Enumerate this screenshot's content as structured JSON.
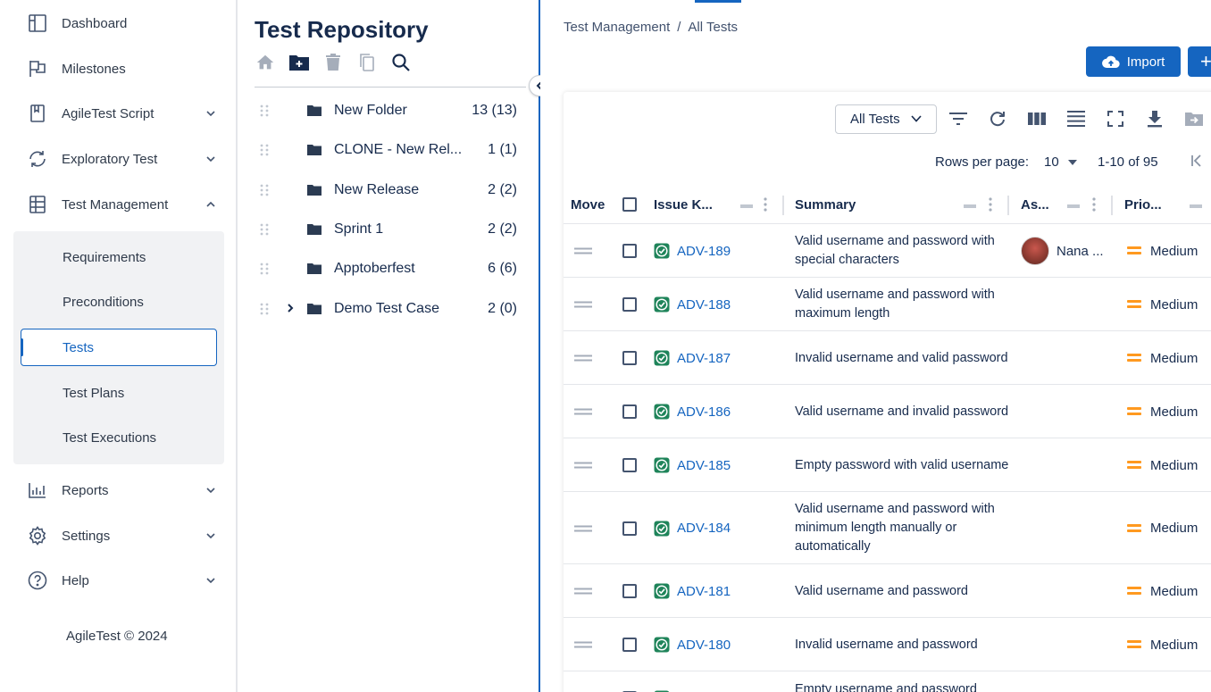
{
  "sidebar": {
    "items": [
      {
        "label": "Dashboard",
        "icon": "dashboard-icon"
      },
      {
        "label": "Milestones",
        "icon": "flag-icon"
      },
      {
        "label": "AgileTest Script",
        "icon": "bookmark-icon"
      },
      {
        "label": "Exploratory Test",
        "icon": "refresh-icon"
      },
      {
        "label": "Test Management",
        "icon": "list-icon"
      },
      {
        "label": "Reports",
        "icon": "bar-chart-icon"
      },
      {
        "label": "Settings",
        "icon": "gear-icon"
      },
      {
        "label": "Help",
        "icon": "help-icon"
      }
    ],
    "subitems": [
      {
        "label": "Requirements"
      },
      {
        "label": "Preconditions"
      },
      {
        "label": "Tests"
      },
      {
        "label": "Test Plans"
      },
      {
        "label": "Test Executions"
      }
    ],
    "active_subitem": "Tests",
    "footer": "AgileTest © 2024"
  },
  "repository": {
    "title": "Test Repository",
    "folders": [
      {
        "name": "New Folder",
        "count": "13 (13)"
      },
      {
        "name": "CLONE - New Rel...",
        "count": "1 (1)"
      },
      {
        "name": "New Release",
        "count": "2 (2)"
      },
      {
        "name": "Sprint 1",
        "count": "2 (2)"
      },
      {
        "name": "Apptoberfest",
        "count": "6 (6)"
      },
      {
        "name": "Demo Test Case",
        "count": "2 (0)"
      }
    ]
  },
  "main": {
    "breadcrumb": [
      "Test Management",
      "/",
      "All Tests"
    ],
    "import_label": "Import",
    "add_label": "+",
    "view_select": "All Tests",
    "pager": {
      "rows_label": "Rows per page:",
      "rows_value": "10",
      "range": "1-10 of 95"
    },
    "columns": {
      "move": "Move",
      "issue_key": "Issue K...",
      "summary": "Summary",
      "assignee": "As...",
      "priority": "Prio..."
    },
    "rows": [
      {
        "key": "ADV-189",
        "summary": "Valid username and password with special characters",
        "assignee": "Nana ...",
        "priority": "Medium"
      },
      {
        "key": "ADV-188",
        "summary": "Valid username and password with maximum length",
        "assignee": "",
        "priority": "Medium"
      },
      {
        "key": "ADV-187",
        "summary": "Invalid username and valid password",
        "assignee": "",
        "priority": "Medium"
      },
      {
        "key": "ADV-186",
        "summary": "Valid username and invalid password",
        "assignee": "",
        "priority": "Medium"
      },
      {
        "key": "ADV-185",
        "summary": "Empty password with valid username",
        "assignee": "",
        "priority": "Medium"
      },
      {
        "key": "ADV-184",
        "summary": "Valid username and password with minimum length manually or automatically",
        "assignee": "",
        "priority": "Medium"
      },
      {
        "key": "ADV-181",
        "summary": "Valid username and password",
        "assignee": "",
        "priority": "Medium"
      },
      {
        "key": "ADV-180",
        "summary": "Invalid username and password",
        "assignee": "",
        "priority": "Medium"
      },
      {
        "key": "",
        "summary": "Empty username and password",
        "assignee": "",
        "priority": ""
      }
    ]
  },
  "colors": {
    "accent": "#1565c0",
    "priority_medium": "#ff991f",
    "issue_icon": "#1f845a"
  }
}
